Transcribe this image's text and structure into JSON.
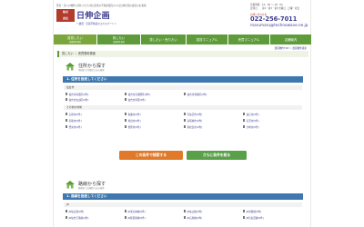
{
  "header": {
    "tagline": "豊島・荒川の物件に携わりまた地元密着の不動産販売の人は日伸企画の最高のお客様",
    "logo_badge_line1": "株式",
    "logo_badge_line2": "会社",
    "logo_name": "日伸企画",
    "logo_sub": "～賃貸・売買不動産のエキスパート～",
    "hours_line1": "営業時間　10：00 ～ 18：00",
    "hours_line2": "定休日　　第1・第3・第5土曜日、日曜・祝日",
    "tel_label": "お問い合わせ先",
    "tel": "022-256-7011",
    "mail": "marumaru@technowave.ne.jp"
  },
  "nav": [
    {
      "label": "賃貸したい",
      "sub": "賃貸物件検索",
      "style": "olive"
    },
    {
      "label": "賃したい",
      "sub": "売買物件検索",
      "style": "green"
    },
    {
      "label": "貸したい・売りたい",
      "sub": "",
      "style": "green"
    },
    {
      "label": "賃貸マニュアル",
      "sub": "",
      "style": "green"
    },
    {
      "label": "売買マニュアル",
      "sub": "",
      "style": "green"
    },
    {
      "label": "店舗案内",
      "sub": "",
      "style": "green"
    }
  ],
  "breadcrumb": "賃貸物件TOP ＞ 賃貸物件検索",
  "section_bar": {
    "part1": "賃したい",
    "part2": "売買物件検索"
  },
  "area_search": {
    "title": "住所から探す",
    "desc": "地域名で住所絞り込み検索",
    "step": "1. 住所を指定してください",
    "group1_label": "仙台市",
    "group1_items": [
      "仙台市青葉区(0件)",
      "仙台市宮城野区(0件)",
      "仙台市若林区(0件)",
      "仙台市太白区(0件)",
      "仙台市泉区(0件)"
    ],
    "group2_label": "その他の地域",
    "group2_items": [
      "石巻市(0件)",
      "塩竈市(0件)",
      "気仙沼市(0件)",
      "白石市(0件)",
      "名取市(0件)",
      "角田市(0件)",
      "多賀城市(0件)",
      "岩沼市(0件)",
      "登米市(0件)",
      "栗原市(0件)",
      "東松島市(0件)",
      "大崎市(0件)"
    ]
  },
  "buttons": {
    "search": "この条件で検索する",
    "more": "さらに条件を絞る"
  },
  "line_search": {
    "title": "路線から探す",
    "desc": "路線名で沿線絞り込み検索",
    "step": "1. 路線を指定してください",
    "group_label": "JR",
    "items": [
      "JR仙石線(0件)",
      "JR東北本線(0件)",
      "JR仙山線(0件)",
      "JR常磐線(0件)",
      "JR仙台空港線(0件)",
      "JR陸羽東線(0件)",
      "JR石巻線(0件)",
      "JR気仙沼線(0件)"
    ]
  }
}
